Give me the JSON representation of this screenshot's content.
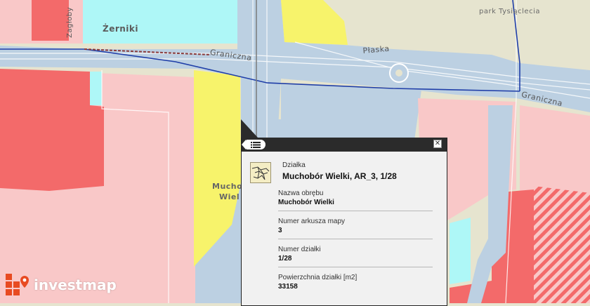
{
  "map": {
    "labels": {
      "zerniki": "Żerniki",
      "park": "park Tysiąclecia",
      "graniczna_west": "Graniczna",
      "plaska": "Płaska",
      "graniczna_east": "Graniczna",
      "zagloby": "Zagłoby",
      "muchobor_line1": "Mucho",
      "muchobor_line2": "Wiel"
    },
    "colors": {
      "background": "#e6e4cf",
      "road": "#bcd0e2",
      "residential": "#f9c8c8",
      "industrial": "#f36a6a",
      "yellow_zone": "#f7f36b",
      "cyan_zone": "#aef7f7",
      "rail": "#1f3ea8"
    }
  },
  "popup": {
    "header_icon": "list-menu-icon",
    "close_symbol": "✕",
    "parcel_icon": "parcel-map-icon",
    "head_label": "Działka",
    "head_title": "Muchobór Wielki, AR_3, 1/28",
    "fields": [
      {
        "label": "Nazwa obrębu",
        "value": "Muchobór Wielki"
      },
      {
        "label": "Numer arkusza mapy",
        "value": "3"
      },
      {
        "label": "Numer działki",
        "value": "1/28"
      },
      {
        "label": "Powierzchnia działki [m2]",
        "value": "33158"
      }
    ]
  },
  "logo": {
    "text": "investmap",
    "color": "#e84a21"
  }
}
